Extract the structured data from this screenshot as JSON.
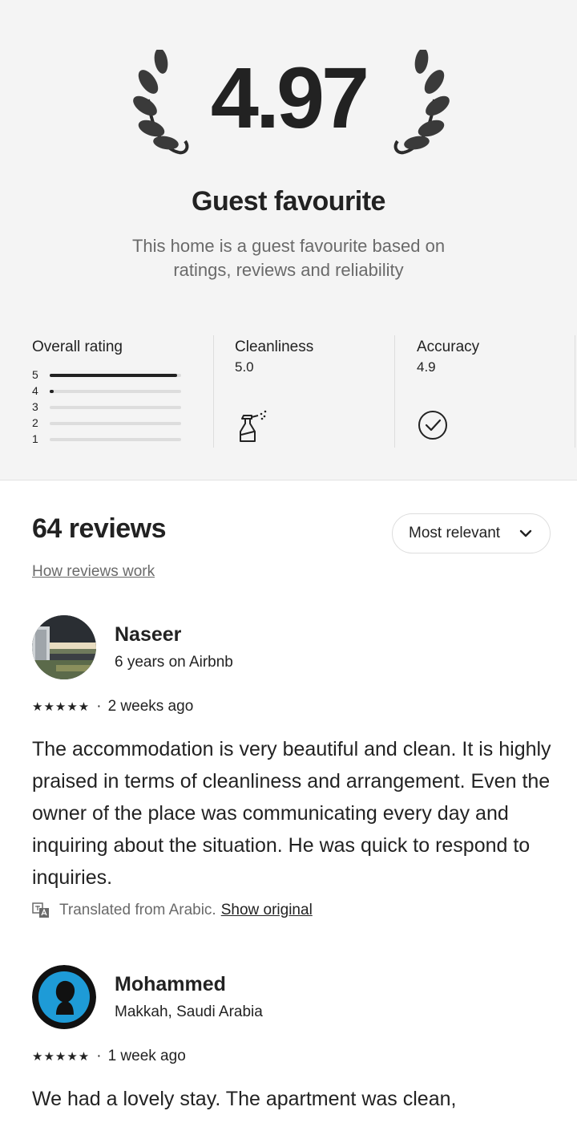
{
  "rating": {
    "score": "4.97",
    "badge_title": "Guest favourite",
    "badge_description": "This home is a guest favourite based on ratings, reviews and reliability"
  },
  "categories": {
    "overall": {
      "title": "Overall rating",
      "distribution": [
        {
          "label": "5",
          "fraction": 0.97
        },
        {
          "label": "4",
          "fraction": 0.03
        },
        {
          "label": "3",
          "fraction": 0.0
        },
        {
          "label": "2",
          "fraction": 0.0
        },
        {
          "label": "1",
          "fraction": 0.0
        }
      ]
    },
    "cleanliness": {
      "title": "Cleanliness",
      "value": "5.0",
      "icon": "spray-bottle-icon"
    },
    "accuracy": {
      "title": "Accuracy",
      "value": "4.9",
      "icon": "check-circle-icon"
    }
  },
  "reviews_section": {
    "count_label": "64 reviews",
    "how_link": "How reviews work",
    "sort_label": "Most relevant"
  },
  "reviews": [
    {
      "name": "Naseer",
      "subtitle": "6 years on Airbnb",
      "stars": "★★★★★",
      "date": "2 weeks ago",
      "text": "The accommodation is very beautiful and clean. It is highly praised in terms of cleanliness and arrangement. Even the owner of the place was communicating every day and inquiring about the situation. He was quick to respond to inquiries.",
      "translated_note": "Translated from Arabic.",
      "show_original": "Show original"
    },
    {
      "name": "Mohammed",
      "subtitle": "Makkah, Saudi Arabia",
      "stars": "★★★★★",
      "date": "1 week ago",
      "text": "We had a lovely stay. The apartment was clean,"
    }
  ],
  "colors": {
    "text": "#222222",
    "muted": "#6a6a6a",
    "hero_bg": "#f4f4f4",
    "avatar_blue": "#1e9bd7"
  }
}
